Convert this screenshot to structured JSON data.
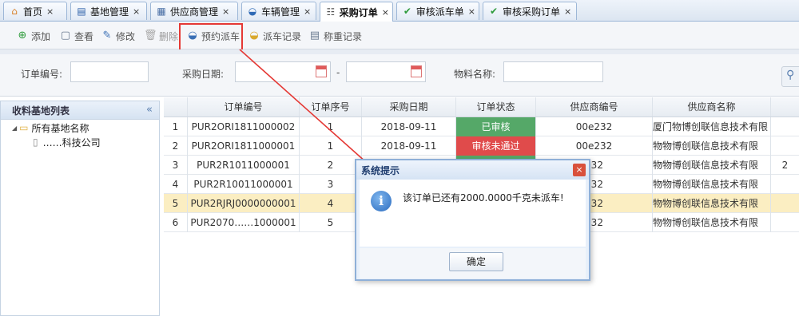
{
  "tabs": [
    {
      "label": "首页",
      "icon": "home-icon",
      "glyph": "⌂",
      "color": "#d9822b"
    },
    {
      "label": "基地管理",
      "icon": "book-icon",
      "glyph": "▤",
      "color": "#2b5fa8"
    },
    {
      "label": "供应商管理",
      "icon": "list-icon",
      "glyph": "▦",
      "color": "#4a6fa5"
    },
    {
      "label": "车辆管理",
      "icon": "car-icon",
      "glyph": "◒",
      "color": "#2f6ab5"
    },
    {
      "label": "采购订单",
      "icon": "list-icon",
      "glyph": "☷",
      "color": "#555555"
    },
    {
      "label": "审核派车单",
      "icon": "check-icon",
      "glyph": "✔",
      "color": "#2e9b3c"
    },
    {
      "label": "审核采购订单",
      "icon": "check-icon",
      "glyph": "✔",
      "color": "#2e9b3c"
    }
  ],
  "tab_close": "×",
  "toolbar": {
    "add": "添加",
    "view": "查看",
    "edit": "修改",
    "delete": "删除",
    "reserve": "预约派车",
    "dispatch_record": "派车记录",
    "weigh_record": "称重记录"
  },
  "search": {
    "order_no_label": "订单编号:",
    "date_label": "采购日期:",
    "dash": "-",
    "material_label": "物料名称:"
  },
  "tree": {
    "title": "收料基地列表",
    "collapse": "«",
    "root": "所有基地名称",
    "child": "……科技公司"
  },
  "grid": {
    "columns": [
      "订单编号",
      "订单序号",
      "采购日期",
      "订单状态",
      "供应商编号",
      "供应商名称"
    ],
    "rows": [
      {
        "no": "1",
        "order": "PUR2ORI1811000002",
        "seq": "1",
        "date": "2018-09-11",
        "status": "已审核",
        "supplier_no": "00e232",
        "supplier": "厦门物博创联信息技术有限"
      },
      {
        "no": "2",
        "order": "PUR2ORI1811000001",
        "seq": "1",
        "date": "2018-09-11",
        "status": "审核未通过",
        "supplier_no": "00e232",
        "supplier": "物物博创联信息技术有限"
      },
      {
        "no": "3",
        "order": "PUR2R1011000001",
        "seq": "2",
        "date": "",
        "status": "",
        "supplier_no": "232",
        "supplier": "物物博创联信息技术有限"
      },
      {
        "no": "4",
        "order": "PUR2R10011000001",
        "seq": "3",
        "date": "",
        "status": "",
        "supplier_no": "232",
        "supplier": "物物博创联信息技术有限"
      },
      {
        "no": "5",
        "order": "PUR2RJRJ0000000001",
        "seq": "4",
        "date": "",
        "status": "",
        "supplier_no": "232",
        "supplier": "物物博创联信息技术有限"
      },
      {
        "no": "6",
        "order": "PUR2070……1000001",
        "seq": "5",
        "date": "",
        "status": "",
        "supplier_no": "232",
        "supplier": "物物博创联信息技术有限"
      }
    ],
    "overflow": "2"
  },
  "dialog": {
    "title": "系统提示",
    "close": "×",
    "info": "i",
    "message": "该订单已还有2000.0000千克未派车!",
    "ok": "确定"
  },
  "colors": {
    "accent": "#e53935",
    "status_ok": "#55a868",
    "status_bad": "#e04b4b",
    "selected_row": "#fbeec2"
  }
}
